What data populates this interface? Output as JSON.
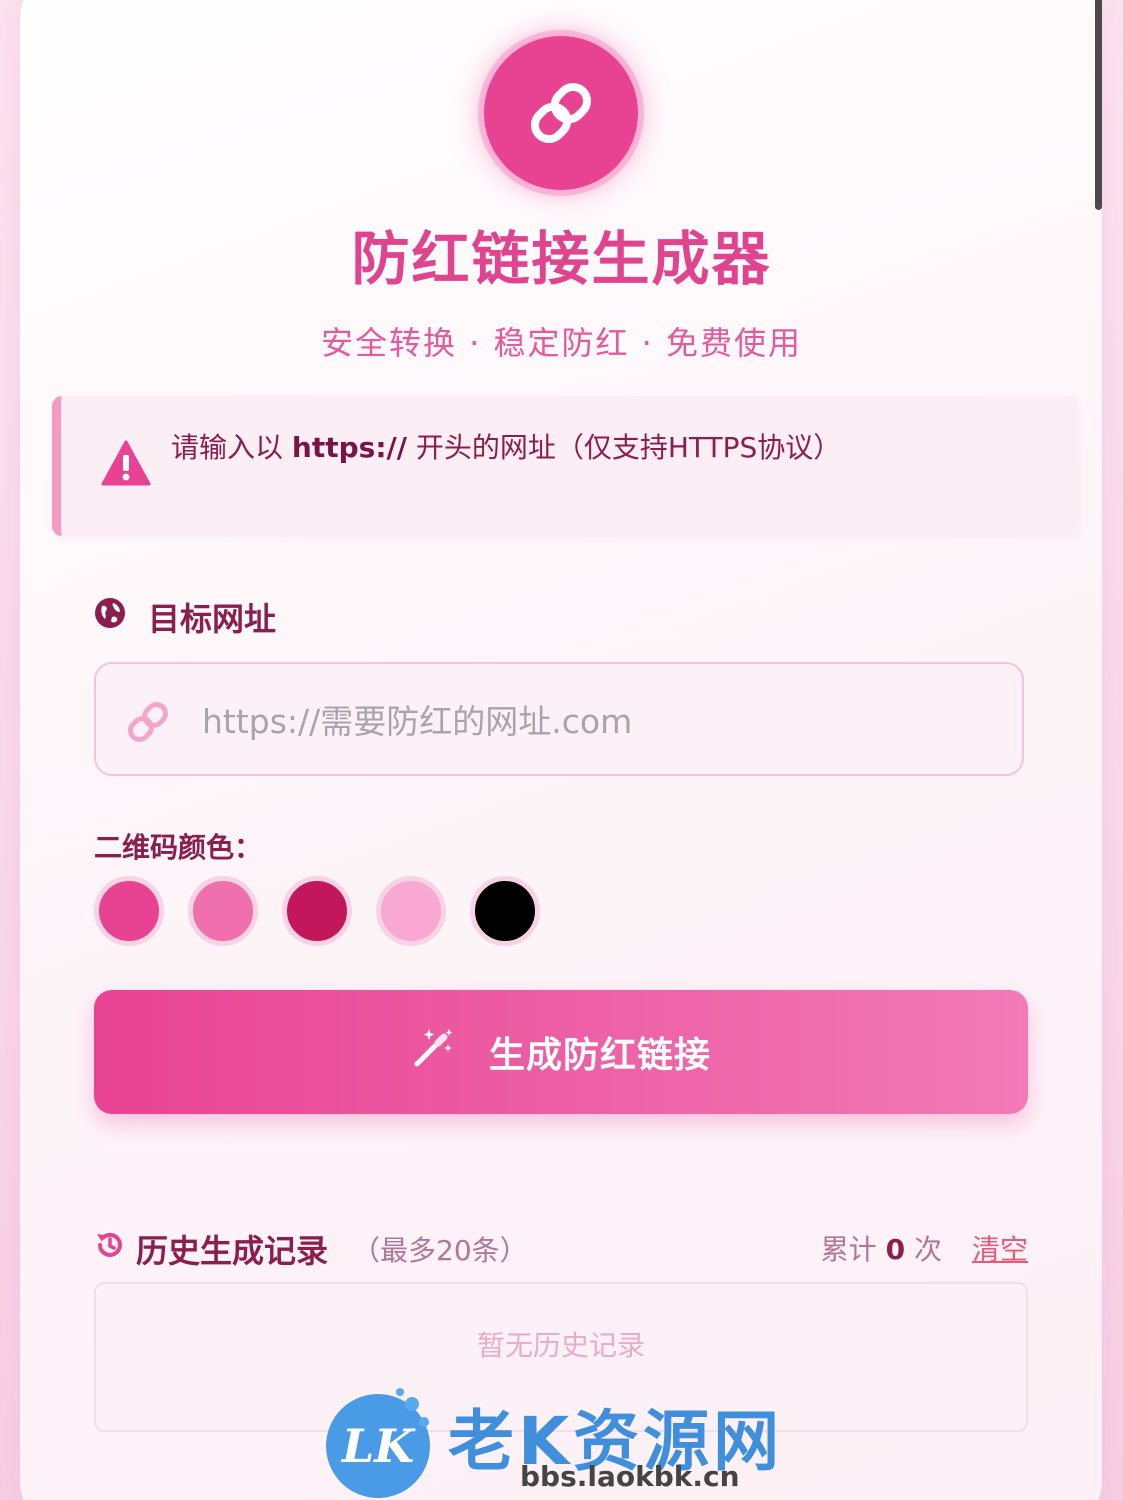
{
  "header": {
    "title": "防红链接生成器",
    "subtitle": "安全转换 · 稳定防红 · 免费使用"
  },
  "notice": {
    "prefix": "请输入以 ",
    "highlight": "https://",
    "suffix": " 开头的网址（仅支持HTTPS协议）"
  },
  "url_section": {
    "label": "目标网址",
    "placeholder": "https://需要防红的网址.com",
    "value": ""
  },
  "qr_color": {
    "label": "二维码颜色：",
    "swatches": [
      "#e84393",
      "#f06fad",
      "#c2185b",
      "#f9a8d4",
      "#000000"
    ]
  },
  "generate_button": {
    "label": "生成防红链接"
  },
  "history": {
    "title": "历史生成记录",
    "note": "（最多20条）",
    "count_prefix": "累计",
    "count": "0",
    "count_suffix": "次",
    "clear_label": "清空",
    "empty_text": "暂无历史记录"
  },
  "watermark": {
    "logo_text": "LK",
    "brand": "老K资源网",
    "url": "bbs.laokbk.cn"
  },
  "colors": {
    "accent": "#e84393",
    "title": "#e0448f",
    "dark_text": "#8a1f4f"
  }
}
